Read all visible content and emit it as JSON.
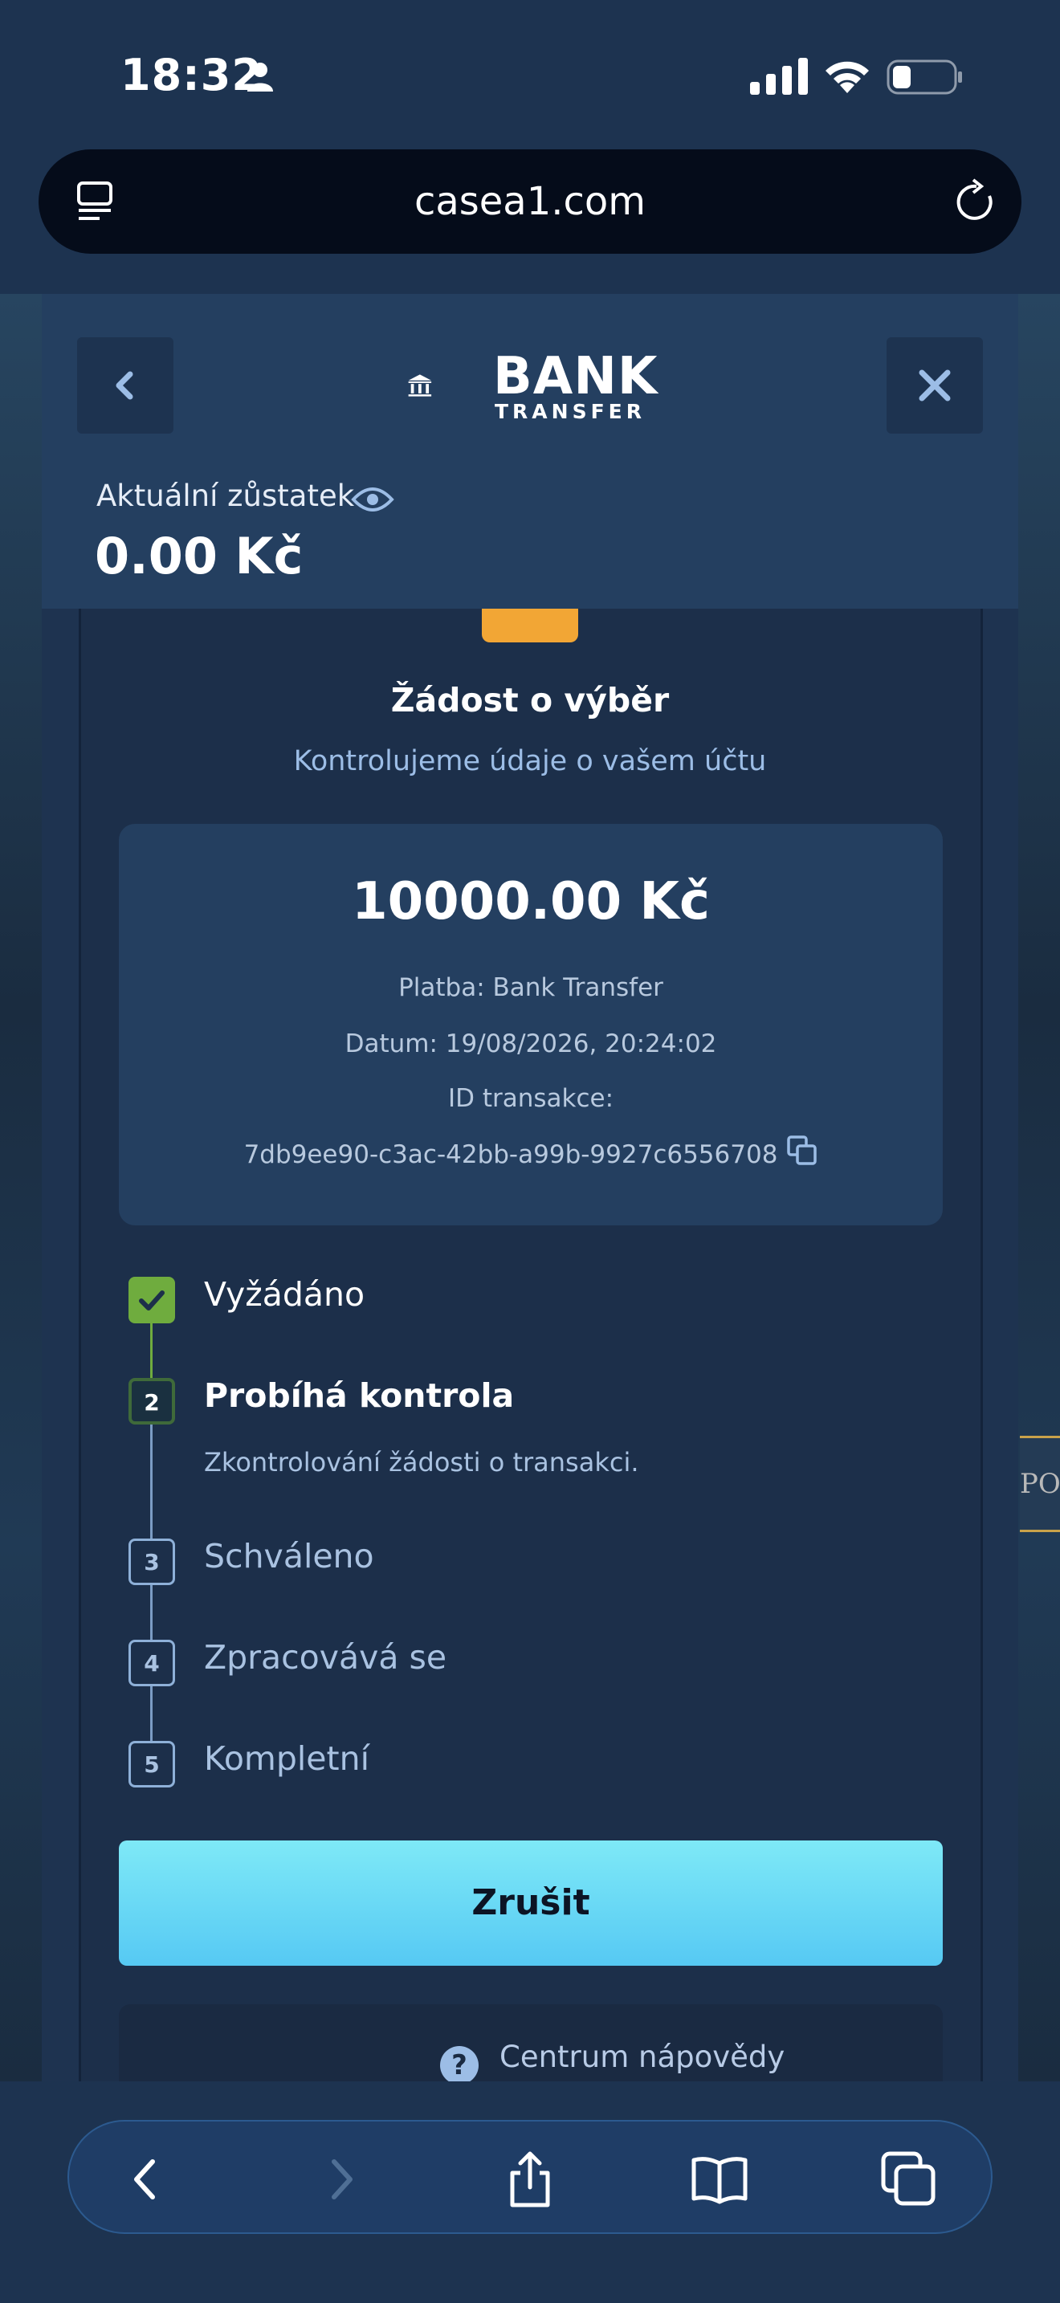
{
  "status_bar": {
    "time": "18:32"
  },
  "browser": {
    "url": "casea1.com"
  },
  "modal": {
    "logo_bank": "BANK",
    "logo_transfer": "TRANSFER",
    "balance_label": "Aktuální zůstatek",
    "balance_value": "0.00 Kč",
    "title": "Žádost o výběr",
    "subtitle": "Kontrolujeme údaje o vašem účtu",
    "amount": "10000.00 Kč",
    "payment_line": "Platba: Bank Transfer",
    "date_line": "Datum: 19/08/2026, 20:24:02",
    "txid_label": "ID transakce:",
    "txid_value": "7db9ee90-c3ac-42bb-a99b-9927c6556708",
    "steps": [
      {
        "number": "1",
        "label": "Vyžádáno",
        "state": "done"
      },
      {
        "number": "2",
        "label": "Probíhá kontrola",
        "state": "active",
        "description": "Zkontrolování žádosti o transakci."
      },
      {
        "number": "3",
        "label": "Schváleno",
        "state": "pending"
      },
      {
        "number": "4",
        "label": "Zpracovává se",
        "state": "pending"
      },
      {
        "number": "5",
        "label": "Kompletní",
        "state": "pending"
      }
    ],
    "cancel_label": "Zrušit",
    "help_icon_glyph": "?",
    "help_label": "Centrum nápovědy"
  },
  "background": {
    "side_text": "PO"
  },
  "colors": {
    "accent_cyan": "#56c9f3",
    "done_green": "#6fac3e",
    "badge_orange": "#f2a635"
  },
  "toolbar": {
    "icons": [
      "back-icon",
      "forward-icon",
      "share-icon",
      "bookmarks-icon",
      "tabs-icon"
    ]
  }
}
